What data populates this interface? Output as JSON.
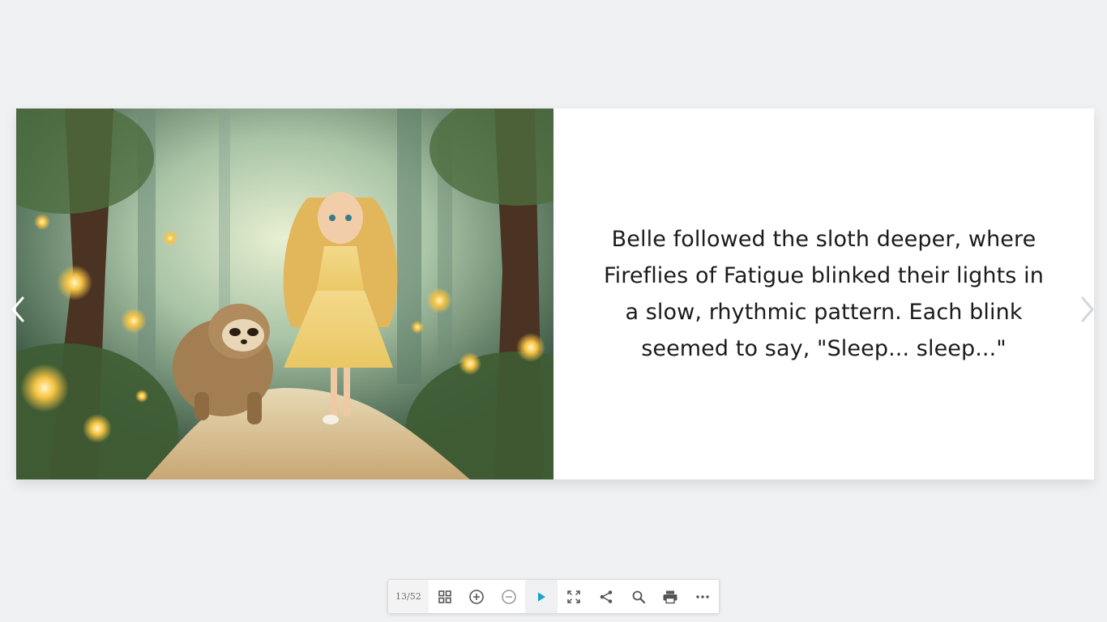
{
  "book": {
    "illustration_alt": "Girl in a yellow dress walking with a sloth through a glowing forest",
    "text": "Belle followed the sloth deeper, where Fireflies of Fatigue blinked their lights in a slow, rhythmic pattern. Each blink seemed to say, \"Sleep... sleep...\""
  },
  "toolbar": {
    "page_counter": "13/52",
    "buttons": [
      {
        "name": "thumbnails",
        "icon": "grid-icon"
      },
      {
        "name": "zoom-in",
        "icon": "plus-circle-icon"
      },
      {
        "name": "zoom-out",
        "icon": "minus-circle-icon"
      },
      {
        "name": "autoplay",
        "icon": "play-icon"
      },
      {
        "name": "fullscreen",
        "icon": "expand-icon"
      },
      {
        "name": "share",
        "icon": "share-icon"
      },
      {
        "name": "search",
        "icon": "search-icon"
      },
      {
        "name": "print",
        "icon": "printer-icon"
      },
      {
        "name": "more",
        "icon": "more-icon"
      }
    ]
  },
  "colors": {
    "accent": "#1aa3c8",
    "icon": "#555555",
    "background": "#f0f1f3"
  }
}
